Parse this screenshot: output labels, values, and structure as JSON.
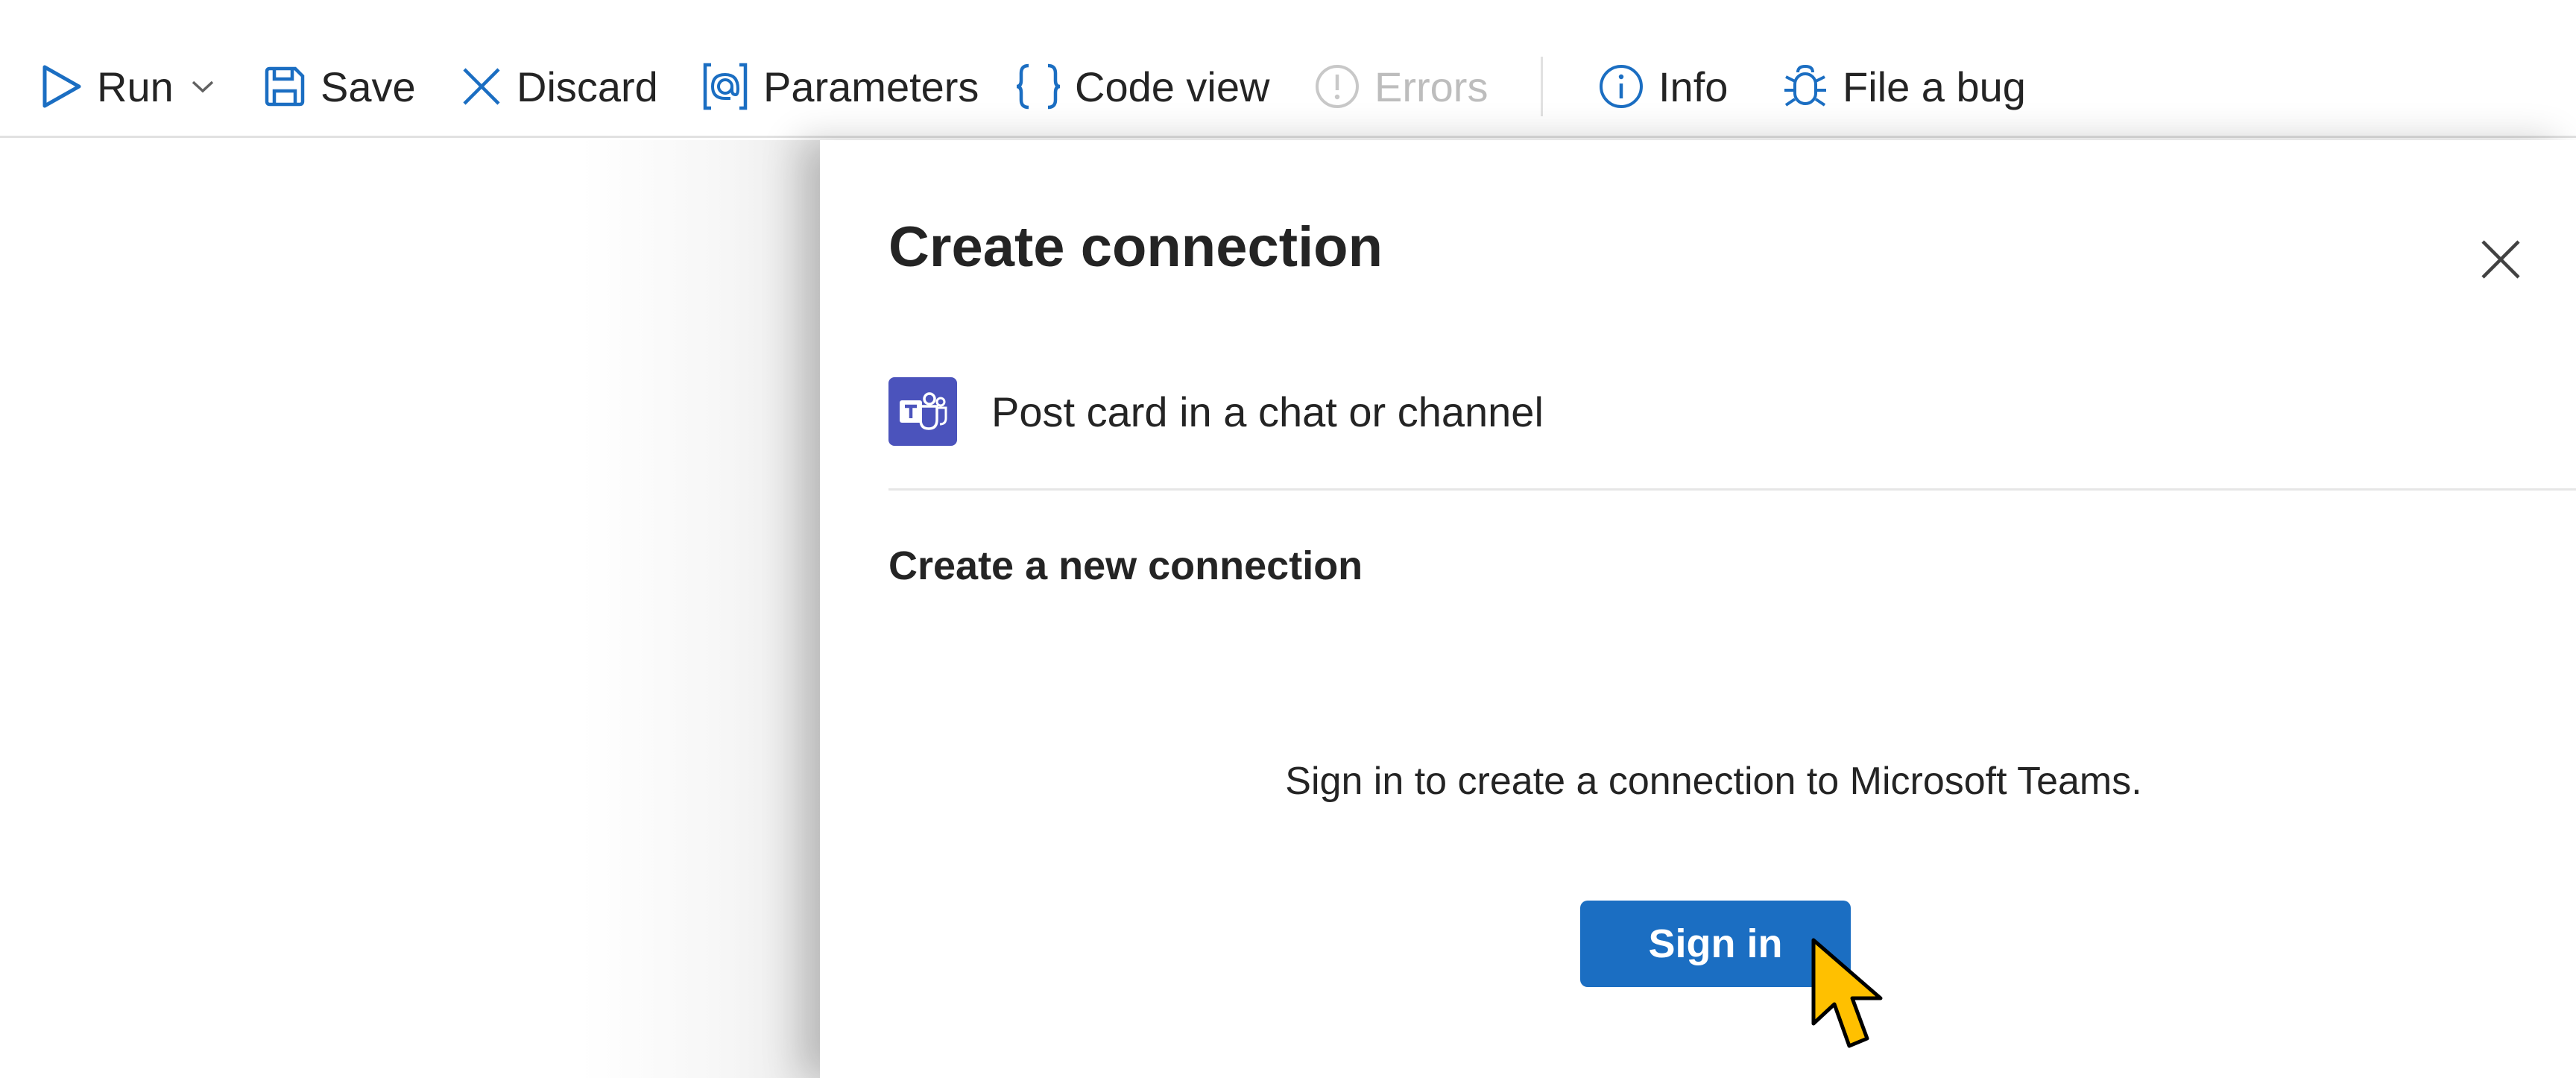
{
  "toolbar": {
    "run_label": "Run",
    "save_label": "Save",
    "discard_label": "Discard",
    "parameters_label": "Parameters",
    "code_view_label": "Code view",
    "errors_label": "Errors",
    "info_label": "Info",
    "file_bug_label": "File a bug",
    "accent_color": "#1b6ec2",
    "disabled_color": "#bdbdbd"
  },
  "panel": {
    "title": "Create connection",
    "action_label": "Post card in a chat or channel",
    "action_icon": "microsoft-teams-icon",
    "teams_color": "#4b53bc",
    "section_title": "Create a new connection",
    "signin_message": "Sign in to create a connection to Microsoft Teams.",
    "signin_button_label": "Sign in",
    "button_color": "#1b6ec2"
  },
  "pointer": {
    "color": "#ffc000",
    "icon": "mouse-pointer-icon"
  }
}
